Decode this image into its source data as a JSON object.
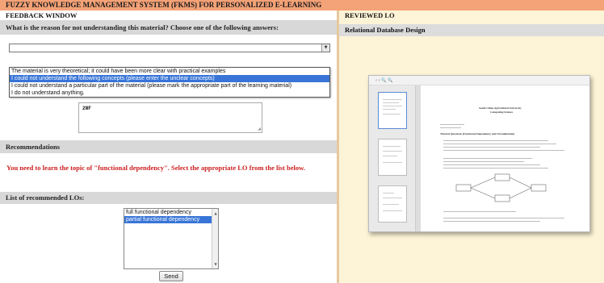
{
  "system_title": "FUZZY KNOWLEDGE MANAGEMENT SYSTEM (FKMS) FOR PERSONALIZED E-LEARNING",
  "feedback": {
    "window_title": "FEEDBACK WINDOW",
    "question": "What is the reason for not understanding this material? Choose one of the following answers:",
    "dropdown_value": "",
    "dropdown_arrow": "▼",
    "options": [
      "The material is very theoretical; it could have been more clear with practical examples",
      "I could not understand the following concepts (please enter the unclear concepts)",
      "I could not understand a particular part of the material (please mark the appropriate part of the learning material)",
      "I do not understand anything."
    ],
    "selected_option_index": 1,
    "concepts_text": "2NF",
    "recommendations_label": "Recommendations",
    "recommendation_text": "You need to learn the topic of \"functional dependency\". Select the appropriate LO from the list below.",
    "lo_list_label": "List of recommended LOs:",
    "lo_items": [
      "full functional dependency",
      "partial functional dependency"
    ],
    "selected_lo_index": 1,
    "send_label": "Send"
  },
  "reviewed": {
    "window_title": "REVIEWED LO",
    "lo_title": "Relational Database Design",
    "doc_toolbar_icons": "‹ › 🔍 🔍",
    "doc_university": "South China Agricultural University",
    "doc_dept": "Computing Science",
    "doc_heading": "Tutorial Questions (Functional Dependency and Normalization)"
  },
  "colors": {
    "title_bar": "#f4a277",
    "right_panel": "#fdf3d6",
    "section_bar": "#d8d8d8",
    "recommendation_text": "#cc1f1f",
    "selection": "#3875d7"
  }
}
